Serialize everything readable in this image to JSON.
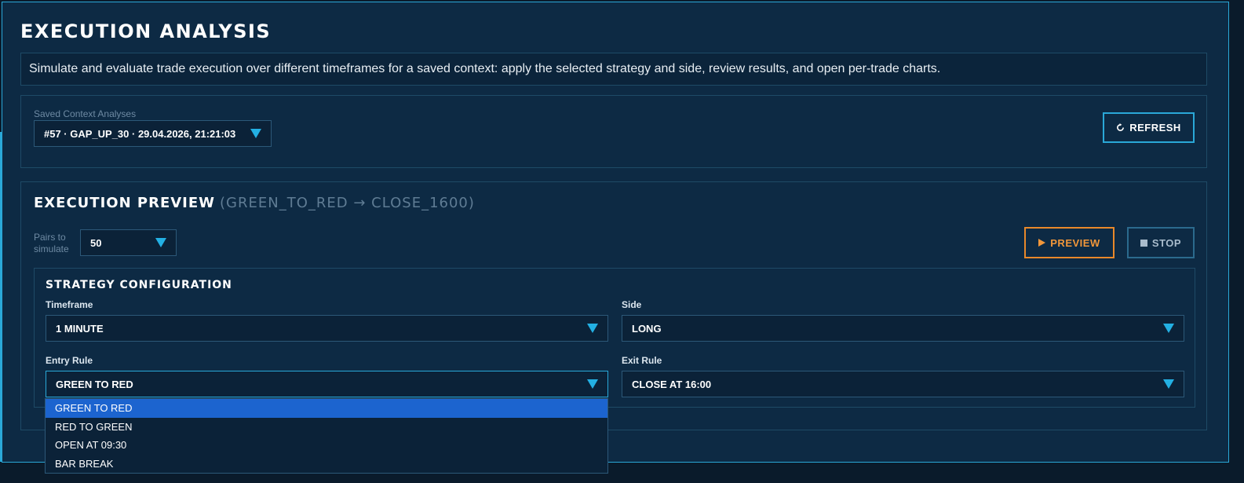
{
  "page": {
    "title": "EXECUTION ANALYSIS",
    "description": "Simulate and evaluate trade execution over different timeframes for a saved context: apply the selected strategy and side, review results, and open per-trade charts."
  },
  "context": {
    "label": "Saved Context Analyses",
    "selected": "#57 · GAP_UP_30 · 29.04.2026, 21:21:03",
    "refresh_icon": "refresh-icon",
    "refresh_label": "REFRESH"
  },
  "preview": {
    "title": "EXECUTION PREVIEW",
    "subtitle": "(GREEN_TO_RED → CLOSE_1600)",
    "pairs_label_1": "Pairs to",
    "pairs_label_2": "simulate",
    "pairs_value": "50",
    "preview_label": "PREVIEW",
    "stop_label": "STOP"
  },
  "strategy": {
    "title": "STRATEGY CONFIGURATION",
    "timeframe_label": "Timeframe",
    "timeframe_value": "1 MINUTE",
    "side_label": "Side",
    "side_value": "LONG",
    "entry_label": "Entry Rule",
    "entry_value": "GREEN TO RED",
    "exit_label": "Exit Rule",
    "exit_value": "CLOSE AT 16:00"
  },
  "entry_dropdown": {
    "options": [
      "GREEN TO RED",
      "RED TO GREEN",
      "OPEN AT 09:30",
      "BAR BREAK"
    ],
    "selected_index": 0
  },
  "colors": {
    "accent": "#2aa8d8",
    "preview_orange": "#e8882a",
    "highlight": "#1c64cf"
  }
}
